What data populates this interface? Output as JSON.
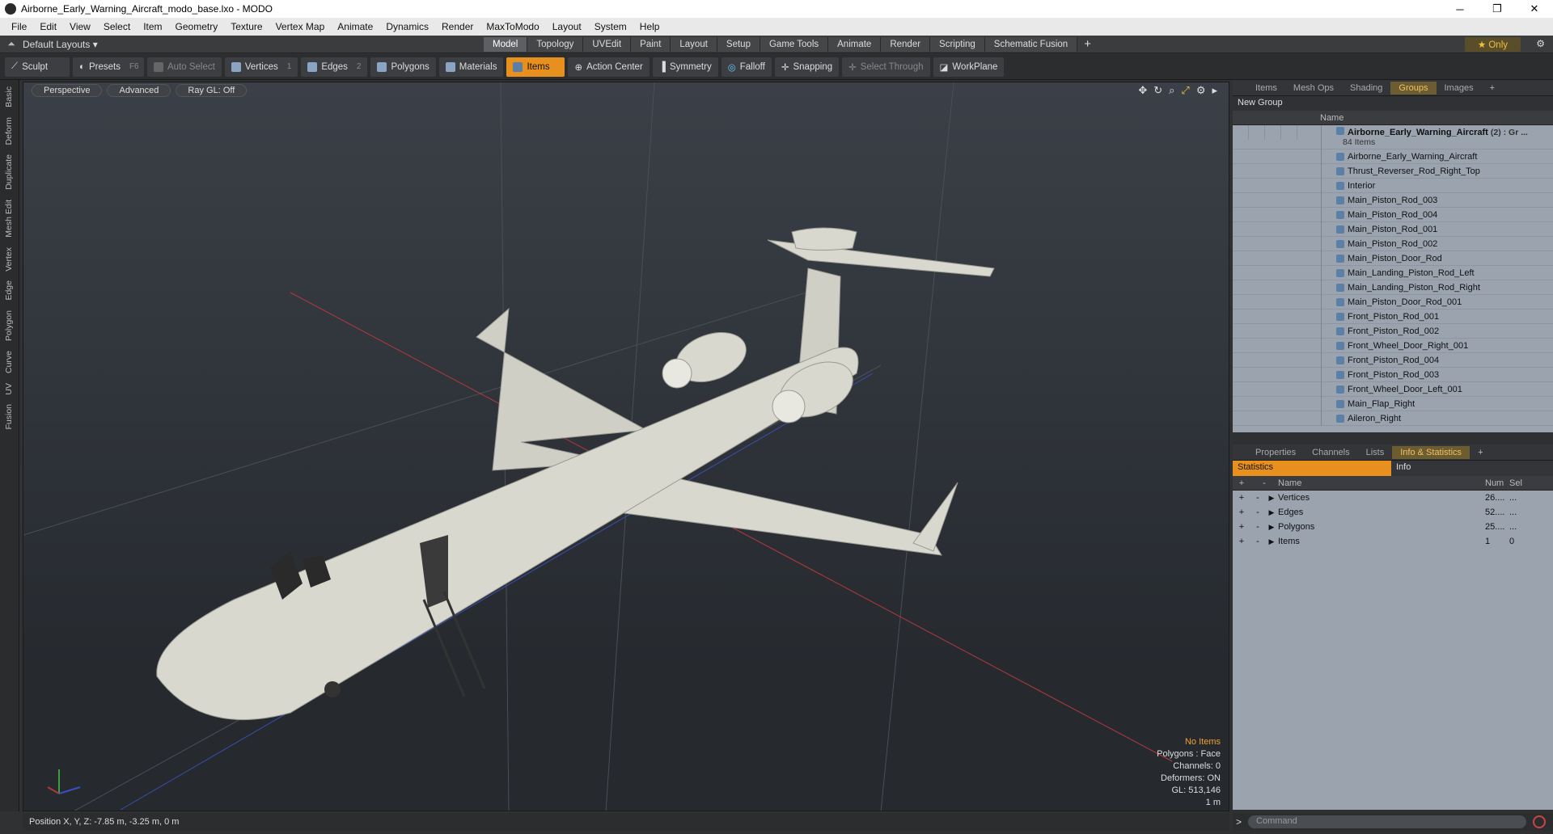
{
  "window": {
    "title": "Airborne_Early_Warning_Aircraft_modo_base.lxo - MODO",
    "min": "─",
    "max": "❐",
    "close": "✕"
  },
  "menu": [
    "File",
    "Edit",
    "View",
    "Select",
    "Item",
    "Geometry",
    "Texture",
    "Vertex Map",
    "Animate",
    "Dynamics",
    "Render",
    "MaxToModo",
    "Layout",
    "System",
    "Help"
  ],
  "layoutbar": {
    "layouts": "Default Layouts ▾",
    "tabs": [
      "Model",
      "Topology",
      "UVEdit",
      "Paint",
      "Layout",
      "Setup",
      "Game Tools",
      "Animate",
      "Render",
      "Scripting",
      "Schematic Fusion"
    ],
    "active_tab": "Model",
    "plus": "+",
    "only": "★  Only",
    "gear": "⚙"
  },
  "toolbar": {
    "sculpt": "Sculpt",
    "presets": "Presets",
    "presets_key": "F6",
    "auto_select": "Auto Select",
    "vertices": "Vertices",
    "vertices_num": "1",
    "edges": "Edges",
    "edges_num": "2",
    "polygons": "Polygons",
    "materials": "Materials",
    "items": "Items",
    "action_center": "Action Center",
    "symmetry": "Symmetry",
    "falloff": "Falloff",
    "snapping": "Snapping",
    "select_through": "Select Through",
    "workplane": "WorkPlane"
  },
  "lefttabs": [
    "Basic",
    "Deform",
    "Duplicate",
    "Mesh Edit",
    "Vertex",
    "Edge",
    "Polygon",
    "Curve",
    "UV",
    "Fusion"
  ],
  "viewport": {
    "view": "Perspective",
    "mode": "Advanced",
    "raygl": "Ray GL: Off",
    "info": {
      "items": "No Items",
      "polygons": "Polygons : Face",
      "channels": "Channels: 0",
      "deformers": "Deformers: ON",
      "gl": "GL: 513,146",
      "scale": "1 m"
    }
  },
  "status": {
    "position": "Position X, Y, Z:  -7.85 m, -3.25 m, 0 m"
  },
  "rightpanel": {
    "tabs": [
      "Items",
      "Mesh Ops",
      "Shading",
      "Groups",
      "Images"
    ],
    "active_tab": "Groups",
    "plus": "+",
    "new_group": "New Group",
    "name_header": "Name",
    "group_name": "Airborne_Early_Warning_Aircraft",
    "group_suffix": "(2) : Gr ...",
    "group_count": "84 Items",
    "items": [
      "Airborne_Early_Warning_Aircraft",
      "Thrust_Reverser_Rod_Right_Top",
      "Interior",
      "Main_Piston_Rod_003",
      "Main_Piston_Rod_004",
      "Main_Piston_Rod_001",
      "Main_Piston_Rod_002",
      "Main_Piston_Door_Rod",
      "Main_Landing_Piston_Rod_Left",
      "Main_Landing_Piston_Rod_Right",
      "Main_Piston_Door_Rod_001",
      "Front_Piston_Rod_001",
      "Front_Piston_Rod_002",
      "Front_Wheel_Door_Right_001",
      "Front_Piston_Rod_004",
      "Front_Piston_Rod_003",
      "Front_Wheel_Door_Left_001",
      "Main_Flap_Right",
      "Aileron_Right"
    ]
  },
  "lowerpanel": {
    "tabs": [
      "Properties",
      "Channels",
      "Lists",
      "Info & Statistics"
    ],
    "active_tab": "Info & Statistics",
    "plus": "+",
    "stat_tab": "Statistics",
    "info_tab": "Info",
    "headers": {
      "name": "Name",
      "num": "Num",
      "sel": "Sel"
    },
    "rows": [
      {
        "name": "Vertices",
        "num": "26....",
        "sel": "..."
      },
      {
        "name": "Edges",
        "num": "52....",
        "sel": "..."
      },
      {
        "name": "Polygons",
        "num": "25....",
        "sel": "..."
      },
      {
        "name": "Items",
        "num": "1",
        "sel": "0"
      }
    ]
  },
  "command": {
    "placeholder": "Command"
  },
  "colors": {
    "accent": "#e8901e",
    "groups_tab": "#f2c060",
    "list_bg": "#9aa3ae",
    "aircraft": "#d6d6ce"
  }
}
